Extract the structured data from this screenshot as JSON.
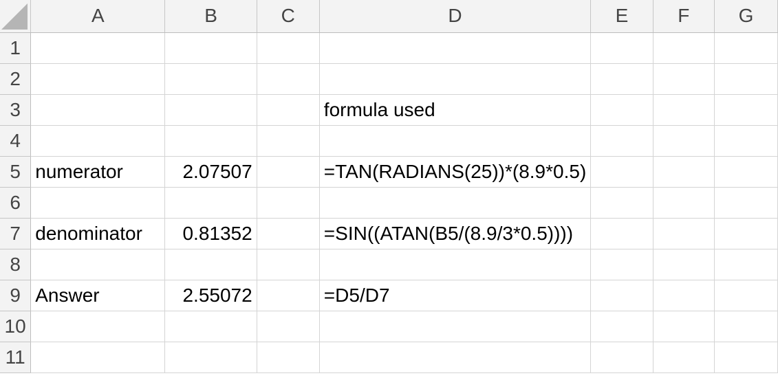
{
  "columns": [
    "A",
    "B",
    "C",
    "D",
    "E",
    "F",
    "G"
  ],
  "rows": [
    {
      "n": "1",
      "A": "",
      "B": "",
      "D": ""
    },
    {
      "n": "2",
      "A": "",
      "B": "",
      "D": ""
    },
    {
      "n": "3",
      "A": "",
      "B": "",
      "D": "formula used"
    },
    {
      "n": "4",
      "A": "",
      "B": "",
      "D": ""
    },
    {
      "n": "5",
      "A": "numerator",
      "B": "2.07507",
      "D": "=TAN(RADIANS(25))*(8.9*0.5)"
    },
    {
      "n": "6",
      "A": "",
      "B": "",
      "D": ""
    },
    {
      "n": "7",
      "A": "denominator",
      "B": "0.81352",
      "D": "=SIN((ATAN(B5/(8.9/3*0.5))))"
    },
    {
      "n": "8",
      "A": "",
      "B": "",
      "D": ""
    },
    {
      "n": "9",
      "A": "Answer",
      "B": "2.55072",
      "D": "=D5/D7"
    },
    {
      "n": "10",
      "A": "",
      "B": "",
      "D": ""
    },
    {
      "n": "11",
      "A": "",
      "B": "",
      "D": ""
    }
  ]
}
